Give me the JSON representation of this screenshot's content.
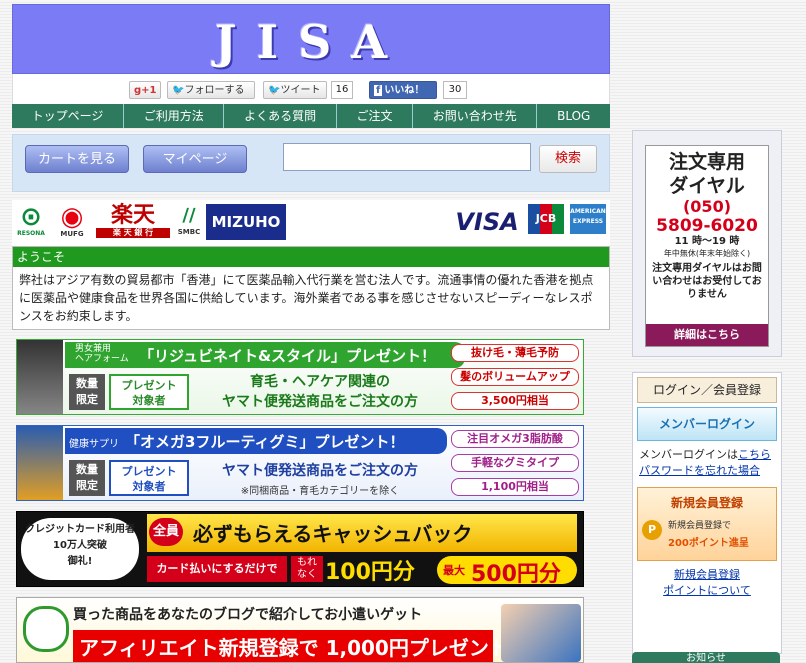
{
  "header": {
    "logo": "JISA"
  },
  "social": {
    "gplus": "g+1",
    "follow": "フォローする",
    "tweet": "ツイート",
    "tweet_count": "16",
    "like": "いいね！",
    "like_count": "30"
  },
  "nav": [
    "トップページ",
    "ご利用方法",
    "よくある質問",
    "ご注文",
    "お問い合わせ先",
    "BLOG"
  ],
  "search": {
    "cart": "カートを見る",
    "mypage": "マイページ",
    "button": "検索",
    "value": ""
  },
  "payments": {
    "resona": "RESONA",
    "mufg": "MUFG",
    "rakuten": "楽天",
    "rakuten_bank": "楽 天 銀 行",
    "smbc": "SMBC",
    "mizuho": "MIZUHO",
    "visa": "VISA",
    "jcb": "JCB",
    "amex": "AMERICAN EXPRESS"
  },
  "welcome": {
    "title": "ようこそ",
    "text": "弊社はアジア有数の貿易都市「香港」にて医薬品輸入代行業を営む法人です。流通事情の優れた香港を拠点に医薬品や健康食品を世界各国に供給しています。海外業者である事を感じさせないスピーディーなレスポンスをお約束します。"
  },
  "banners": {
    "b1": {
      "tag": "男女兼用\nヘアフォーム",
      "title": "「リジュビネイト&スタイル」プレゼント！",
      "left1": "数量\n限定",
      "left2": "プレゼント\n対象者",
      "main": "育毛・ヘアケア関連の\nヤマト便発送商品をご注文の方",
      "r1": "抜け毛・薄毛予防",
      "r2": "髪のボリュームアップ",
      "r3": "3,500円相当"
    },
    "b2": {
      "tag": "健康サプリ",
      "title": "「オメガ3フルーティグミ」プレゼント！",
      "left1": "数量\n限定",
      "left2": "プレゼント\n対象者",
      "main": "ヤマト便発送商品をご注文の方",
      "sub": "※同梱商品・育毛カテゴリーを除く",
      "r1": "注目オメガ3脂肪酸",
      "r2": "手軽なグミタイプ",
      "r3": "1,100円相当"
    },
    "b3": {
      "left": "クレジットカード利用者\n10万人突破\n御礼!",
      "badge": "全員",
      "title": "必ずもらえるキャッシュバック",
      "sub": "カード払いにするだけで",
      "motore": "もれ\nなく",
      "amount1": "100円分",
      "max": "最大",
      "amount2": "500円分"
    },
    "b4": {
      "line1": "買った商品をあなたのブログで紹介してお小遣いゲット",
      "line2": "アフィリエイト新規登録で 1,000円プレゼント"
    }
  },
  "sidebar": {
    "tel": {
      "title": "注文専用\nダイヤル",
      "area": "(050)",
      "number": "5809-6020",
      "hours": "11 時～19 時",
      "holiday": "年中無休(年末年始除く)",
      "note": "注文専用ダイヤルはお問い合わせはお受付しておりません",
      "detail": "詳細はこちら"
    },
    "login": {
      "title": "ログイン／会員登録",
      "member_login": "メンバーログイン",
      "text1": "メンバーログインは",
      "link1": "こちら",
      "link2": "パスワードを忘れた場合",
      "register": "新規会員登録",
      "reg_sub": "新規会員登録で",
      "points": "200ポイント進呈",
      "link3": "新規会員登録",
      "link4": "ポイントについて"
    },
    "news": "お知らせ"
  }
}
